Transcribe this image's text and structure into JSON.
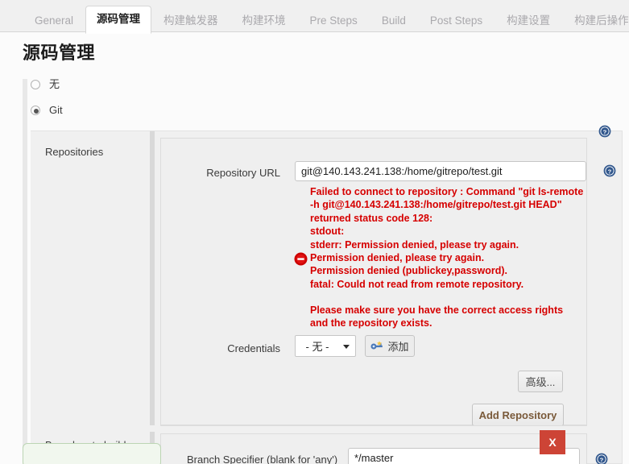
{
  "tabs": [
    {
      "label": "General",
      "active": false
    },
    {
      "label": "源码管理",
      "active": true
    },
    {
      "label": "构建触发器",
      "active": false
    },
    {
      "label": "构建环境",
      "active": false
    },
    {
      "label": "Pre Steps",
      "active": false
    },
    {
      "label": "Build",
      "active": false
    },
    {
      "label": "Post Steps",
      "active": false
    },
    {
      "label": "构建设置",
      "active": false
    },
    {
      "label": "构建后操作",
      "active": false
    }
  ],
  "page": {
    "title": "源码管理"
  },
  "scm_options": [
    {
      "label": "无",
      "selected": false
    },
    {
      "label": "Git",
      "selected": true
    }
  ],
  "repositories": {
    "section_label": "Repositories",
    "repository_url": {
      "label": "Repository URL",
      "value": "git@140.143.241.138:/home/gitrepo/test.git",
      "placeholder": ""
    },
    "error": {
      "icon": "error-circle-icon",
      "color": "#d60000",
      "message": "Failed to connect to repository : Command \"git ls-remote\n-h git@140.143.241.138:/home/gitrepo/test.git HEAD\"\nreturned status code 128:\nstdout:\nstderr: Permission denied, please try again.\nPermission denied, please try again.\nPermission denied (publickey,password).\nfatal: Could not read from remote repository.",
      "footer": "Please make sure you have the correct access rights\nand the repository exists."
    },
    "credentials": {
      "label": "Credentials",
      "selected": "- 无 -",
      "options": [
        "- 无 -"
      ],
      "add_button": "添加",
      "add_button_icon": "key-icon"
    },
    "advanced_button": "高级...",
    "add_repository_button": "Add Repository"
  },
  "branches": {
    "section_label": "Branches to build",
    "branch_specifier": {
      "label": "Branch Specifier (blank for 'any')",
      "value": "*/master"
    },
    "delete_button": "X"
  },
  "icons": {
    "help": "help-icon"
  },
  "colors": {
    "error_red": "#d60000",
    "delete_red": "#cd4436",
    "help_blue": "#31578d",
    "accent_key": "#4a78b8"
  }
}
